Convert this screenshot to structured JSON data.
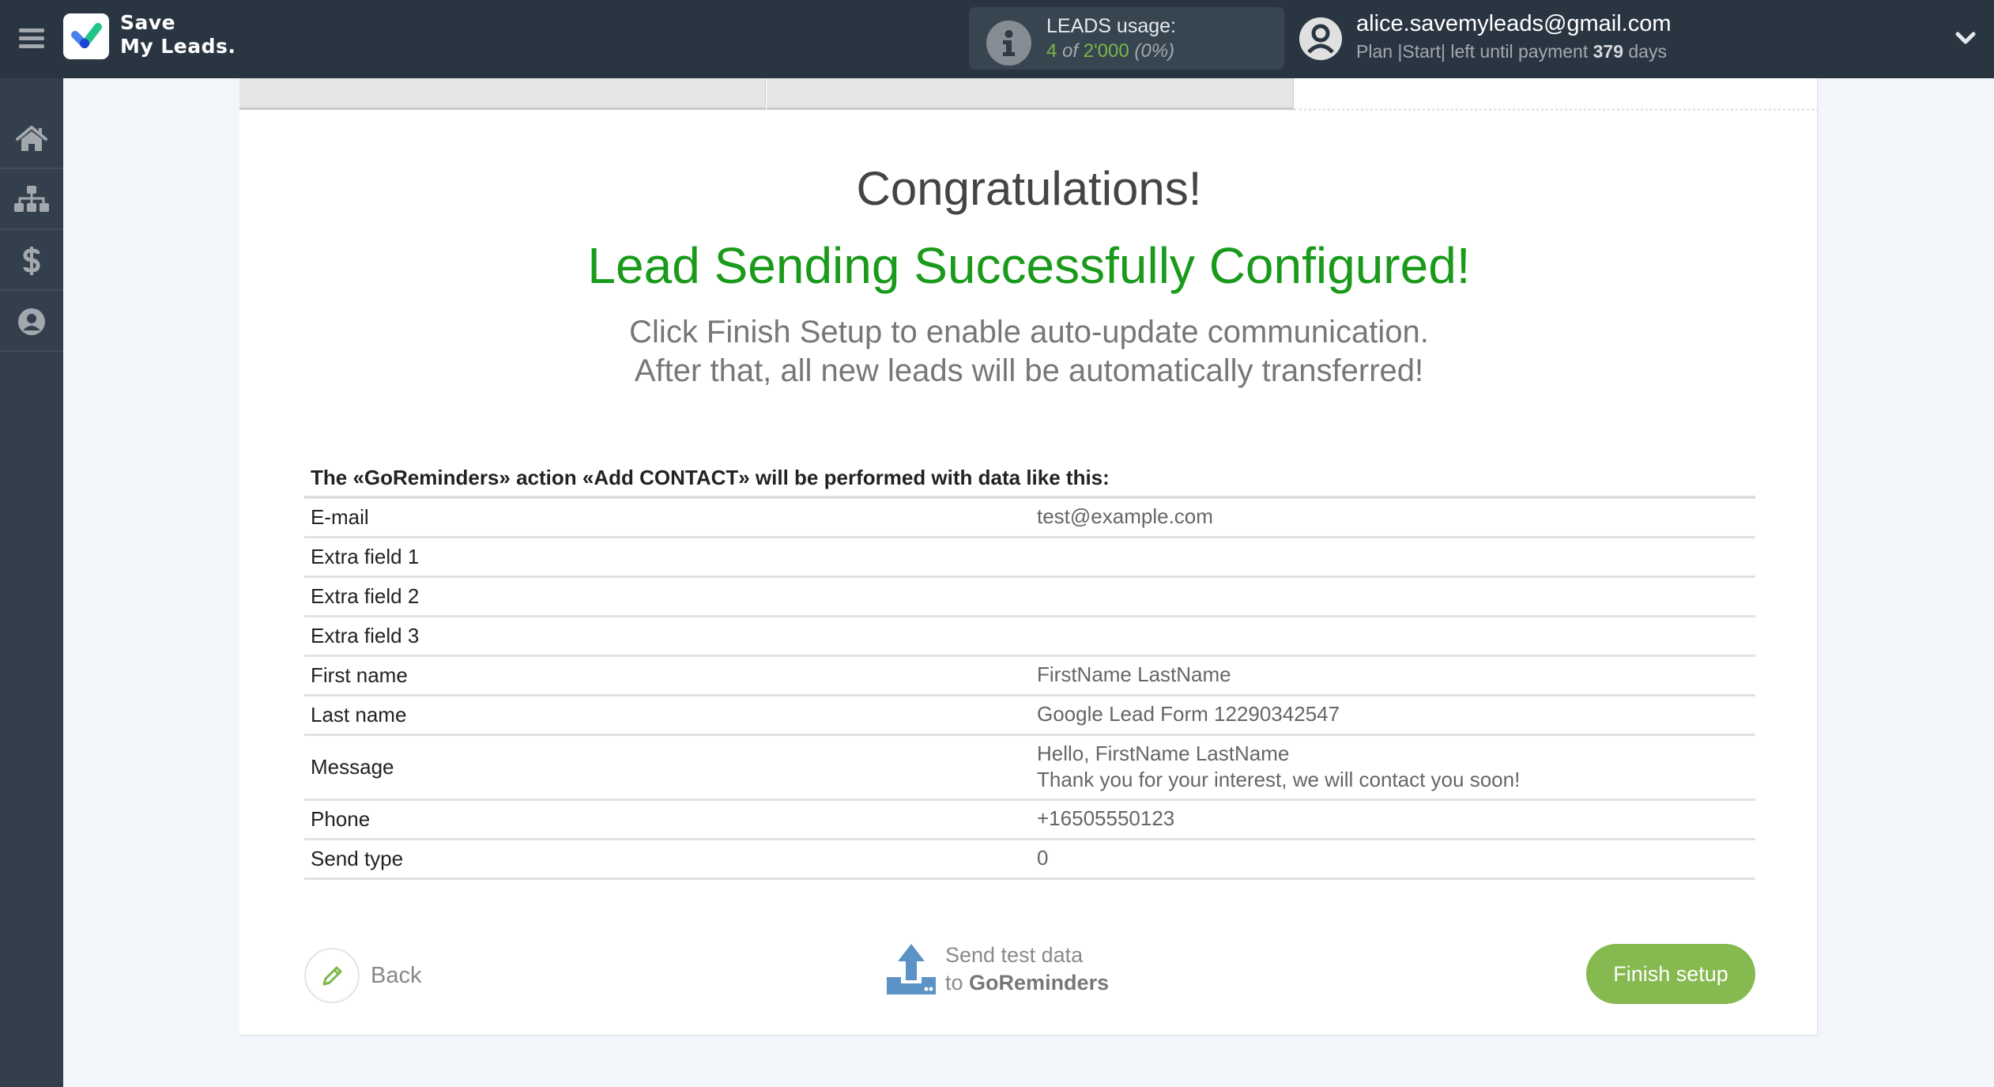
{
  "header": {
    "logo_line1": "Save",
    "logo_line2": "My Leads.",
    "usage_label": "LEADS usage:",
    "usage_used": "4",
    "usage_of": "of",
    "usage_total": "2'000",
    "usage_percent": "(0%)",
    "account_email": "alice.savemyleads@gmail.com",
    "plan_prefix": "Plan |Start| left until payment",
    "plan_days": "379",
    "plan_suffix": "days"
  },
  "sidebar": {
    "items": [
      {
        "name": "home",
        "icon": "home-icon"
      },
      {
        "name": "connections",
        "icon": "sitemap-icon"
      },
      {
        "name": "billing",
        "icon": "dollar-icon"
      },
      {
        "name": "account",
        "icon": "user-circle-icon"
      }
    ]
  },
  "main": {
    "congrats": "Congratulations!",
    "success": "Lead Sending Successfully Configured!",
    "instruction_line1": "Click Finish Setup to enable auto-update communication.",
    "instruction_line2": "After that, all new leads will be automatically transferred!",
    "table_heading": "The «GoReminders» action «Add CONTACT» will be performed with data like this:",
    "rows": [
      {
        "field": "E-mail",
        "value": "test@example.com"
      },
      {
        "field": "Extra field 1",
        "value": ""
      },
      {
        "field": "Extra field 2",
        "value": ""
      },
      {
        "field": "Extra field 3",
        "value": ""
      },
      {
        "field": "First name",
        "value": "FirstName LastName"
      },
      {
        "field": "Last name",
        "value": "Google Lead Form 12290342547"
      },
      {
        "field": "Message",
        "value": "Hello, FirstName LastName",
        "value2": "Thank you for your interest, we will contact you soon!"
      },
      {
        "field": "Phone",
        "value": "+16505550123"
      },
      {
        "field": "Send type",
        "value": "0"
      }
    ]
  },
  "actions": {
    "back_label": "Back",
    "send_line1": "Send test data",
    "send_to": "to",
    "send_target": "GoReminders",
    "finish_label": "Finish setup"
  },
  "colors": {
    "header_bg": "#2a3542",
    "sidebar_bg": "#333f4c",
    "success_green": "#1a9a1a",
    "finish_button": "#86b950",
    "usage_green": "#7ab648",
    "upload_blue": "#5b93c7"
  }
}
